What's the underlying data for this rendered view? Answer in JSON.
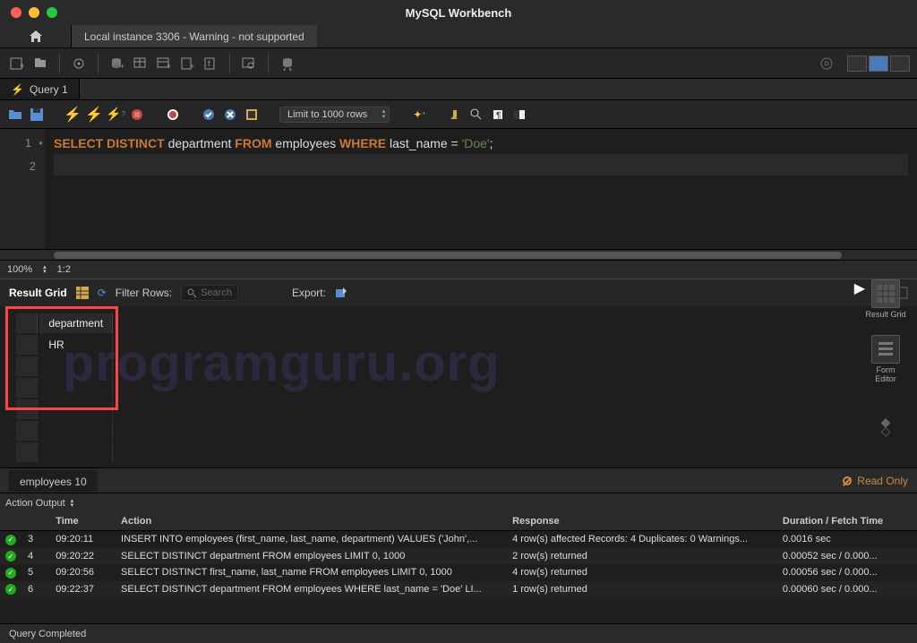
{
  "app_title": "MySQL Workbench",
  "connection_tab": "Local instance 3306 - Warning - not supported",
  "query_tab": "Query 1",
  "limit_dropdown": "Limit to 1000 rows",
  "editor": {
    "line1": {
      "kw1": "SELECT",
      "kw2": "DISTINCT",
      "ident1": "department",
      "kw3": "FROM",
      "ident2": "employees",
      "kw4": "WHERE",
      "ident3": "last_name",
      "op": "=",
      "str": "'Doe'",
      "semi": ";"
    },
    "lines": [
      "1",
      "2"
    ]
  },
  "zoom": "100%",
  "cursor_pos": "1:2",
  "result_toolbar": {
    "label": "Result Grid",
    "filter_label": "Filter Rows:",
    "search_placeholder": "Search",
    "export_label": "Export:"
  },
  "side_panel": {
    "item1": "Result\nGrid",
    "item2": "Form\nEditor"
  },
  "grid": {
    "column": "department",
    "row1": "HR"
  },
  "watermark": "programguru.org",
  "result_tab": "employees 10",
  "readonly": "Read Only",
  "output_type": "Action Output",
  "log_headers": {
    "time": "Time",
    "action": "Action",
    "response": "Response",
    "duration": "Duration / Fetch Time"
  },
  "log": [
    {
      "n": "3",
      "t": "09:20:11",
      "a": "INSERT INTO employees (first_name, last_name, department) VALUES ('John',...",
      "r": "4 row(s) affected Records: 4  Duplicates: 0  Warnings...",
      "d": "0.0016 sec"
    },
    {
      "n": "4",
      "t": "09:20:22",
      "a": "SELECT DISTINCT department FROM employees LIMIT 0, 1000",
      "r": "2 row(s) returned",
      "d": "0.00052 sec / 0.000..."
    },
    {
      "n": "5",
      "t": "09:20:56",
      "a": "SELECT DISTINCT first_name, last_name FROM employees LIMIT 0, 1000",
      "r": "4 row(s) returned",
      "d": "0.00056 sec / 0.000..."
    },
    {
      "n": "6",
      "t": "09:22:37",
      "a": "SELECT DISTINCT department FROM employees WHERE last_name = 'Doe' LI...",
      "r": "1 row(s) returned",
      "d": "0.00060 sec / 0.000..."
    }
  ],
  "status": "Query Completed"
}
